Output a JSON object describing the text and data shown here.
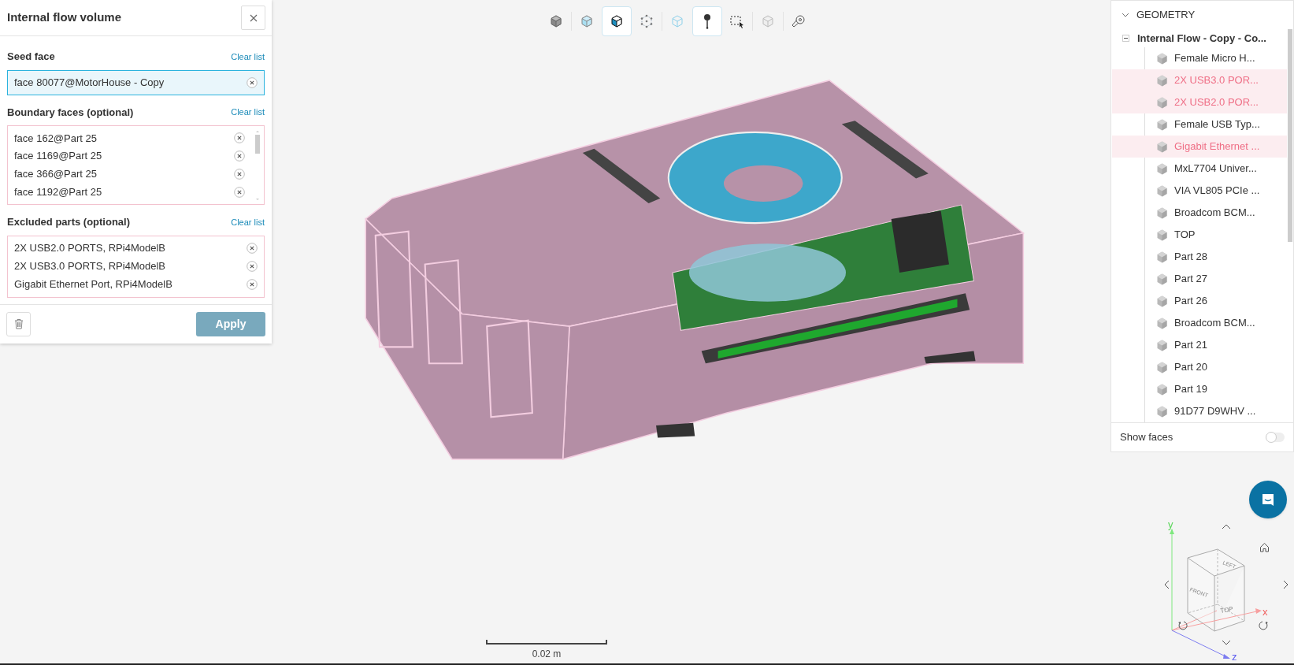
{
  "panel": {
    "title": "Internal flow volume",
    "sections": [
      {
        "kind": "seed",
        "label": "Seed face",
        "action": "Clear list",
        "items": [
          "face 80077@MotorHouse - Copy"
        ]
      },
      {
        "kind": "scroll",
        "label": "Boundary faces (optional)",
        "action": "Clear list",
        "items": [
          "face 162@Part 25",
          "face 1169@Part 25",
          "face 366@Part 25",
          "face 1192@Part 25"
        ]
      },
      {
        "kind": "list",
        "label": "Excluded parts (optional)",
        "action": "Clear list",
        "items": [
          "2X USB2.0 PORTS, RPi4ModelB",
          "2X USB3.0 PORTS, RPi4ModelB",
          "Gigabit Ethernet Port, RPi4ModelB"
        ]
      }
    ],
    "apply": "Apply"
  },
  "toolbar": [
    {
      "kind": "solid-cube",
      "selected": false
    },
    {
      "kind": "transparent-cube",
      "selected": false
    },
    {
      "kind": "faces-cube",
      "selected": true
    },
    {
      "kind": "vertices-cube",
      "selected": false
    },
    {
      "kind": "wire-cube",
      "selected": false
    },
    {
      "kind": "pin",
      "selected": true
    },
    {
      "kind": "box-select",
      "selected": false
    },
    {
      "kind": "hidden-cube",
      "selected": false
    },
    {
      "kind": "measure",
      "selected": false
    }
  ],
  "tree": {
    "title": "GEOMETRY",
    "expanded": true,
    "root": {
      "label": "Internal Flow - Copy - Co...",
      "expanded": true,
      "children": [
        {
          "label": "Female Micro H...",
          "excluded": false
        },
        {
          "label": "2X USB3.0 POR...",
          "excluded": true
        },
        {
          "label": "2X USB2.0 POR...",
          "excluded": true
        },
        {
          "label": "Female USB Typ...",
          "excluded": false
        },
        {
          "label": "Gigabit Ethernet ...",
          "excluded": true
        },
        {
          "label": "MxL7704 Univer...",
          "excluded": false
        },
        {
          "label": "VIA VL805 PCIe ...",
          "excluded": false
        },
        {
          "label": "Broadcom BCM...",
          "excluded": false
        },
        {
          "label": "TOP",
          "excluded": false
        },
        {
          "label": "Part 28",
          "excluded": false
        },
        {
          "label": "Part 27",
          "excluded": false
        },
        {
          "label": "Part 26",
          "excluded": false
        },
        {
          "label": "Broadcom BCM...",
          "excluded": false
        },
        {
          "label": "Part 21",
          "excluded": false
        },
        {
          "label": "Part 20",
          "excluded": false
        },
        {
          "label": "Part 19",
          "excluded": false
        },
        {
          "label": "91D77 D9WHV ...",
          "excluded": false
        }
      ]
    },
    "show_faces": {
      "label": "Show faces",
      "on": false
    }
  },
  "nav_cube": {
    "faces": [
      "LEFT",
      "FRONT",
      "TOP"
    ],
    "axes": [
      "y",
      "x",
      "z"
    ]
  },
  "scale_bar": "0.02 m"
}
